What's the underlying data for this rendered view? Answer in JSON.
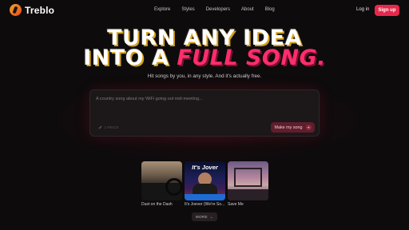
{
  "brand": {
    "name": "Treblo",
    "accent_color": "#e8284b"
  },
  "nav": {
    "links": [
      "Explore",
      "Styles",
      "Developers",
      "About",
      "Blog"
    ],
    "login_label": "Log in",
    "signup_label": "Sign up"
  },
  "hero": {
    "line1": "TURN ANY IDEA",
    "line2_prefix": "INTO A ",
    "line2_accent": "FULL SONG.",
    "subtitle": "Hit songs by you, in any style. And it's actually free."
  },
  "prompt": {
    "placeholder": "A country song about my WiFi going out mid-meeting...",
    "chip_label": "LYRICS",
    "submit_label": "Make my song"
  },
  "songs": [
    {
      "title": "Dust on the Dash",
      "art_text": ""
    },
    {
      "title": "It's Joever (We're So...",
      "art_text": "It's Jover"
    },
    {
      "title": "Save Me",
      "art_text": ""
    }
  ],
  "more_label": "MORE"
}
